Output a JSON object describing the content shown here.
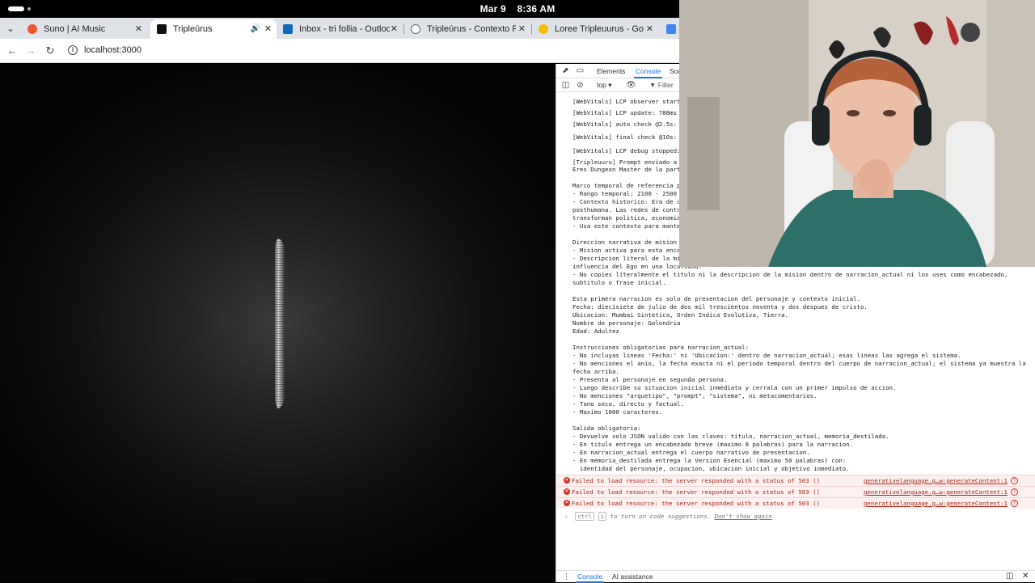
{
  "os": {
    "date": "Mar 9",
    "time": "8:36 AM"
  },
  "tabs": [
    {
      "label": "Suno | AI Music",
      "color": "#e85a2c"
    },
    {
      "label": "Tripleūrus",
      "color": "#111111"
    },
    {
      "label": "Inbox - tri follia - Outlook",
      "color": "#0f6cbd"
    },
    {
      "label": "Tripleūrus - Contexto Pr",
      "color": "#666666"
    },
    {
      "label": "Loree Tripleuurus - Goo",
      "color": "#fbbc04"
    }
  ],
  "address": {
    "url": "localhost:3000"
  },
  "devtools": {
    "tabs": {
      "elements": "Elements",
      "console": "Console",
      "sources": "Sou"
    },
    "context": "top",
    "filter": "Filter",
    "log_lines": [
      "[WebVitals] LCP observer starte",
      "[WebVitals] LCP update: 788ms",
      "[WebVitals] auto check @2.5s:",
      "[WebVitals] final check @10s:",
      "[WebVitals] LCP debug stopped:",
      "[Tripleuuru] Prompt enviado a",
      "Eres Dungeon Master de la part",
      "Marco temporal de referencia p",
      "- Rango temporal: 2100 - 2500",
      "- Contexto historico: Era de c",
      "posthumana. Las redes de contr",
      "transforman politica, economia",
      "- Usa este contexto para mante",
      "Direccion narrativa de mision",
      "- Mision activa para esta enca",
      "- Descripcion literal de la mi",
      "influencia del Ego en una localidad.",
      "- No copies literalmente el titulo ni la descripcion de la mision dentro de narracion_actual ni los uses como encabezado,",
      "subtitulo o frase inicial.",
      "Esta primera narracion es solo de presentacion del personaje y contexto inicial.",
      "Fecha: diecisiete de julio de dos mil trescientos noventa y dos despues de cristo.",
      "Ubicacion: Mumbai Sintetica, Orden Indica Evolutiva, Tierra.",
      "Nombre de personaje: Golondria",
      "Edad: Adultez",
      "Instrucciones obligatorias para narracion_actual:",
      "- No incluyas lineas 'Fecha:' ni 'Ubicacion:' dentro de narracion_actual; esas lineas las agrega el sistema.",
      "- No menciones el anio, la fecha exacta ni el periodo temporal dentro del cuerpo de narracion_actual; el sistema ya muestra la",
      "fecha arriba.",
      "- Presenta al personaje en segunda persona.",
      "- Luego describe su situacion inicial inmediata y cerrala con un primer impulso de accion.",
      "- No menciones \"arquetipo\", \"prompt\", \"sistema\", ni metacomentarios.",
      "- Tono seco, directo y factual.",
      "- Maximo 1000 caracteres.",
      "Salida obligatoria:",
      "- Devuelve solo JSON valido con las claves: titulo, narracion_actual, memoria_destilada.",
      "- En titulo entrega un encabezado breve (maximo 8 palabras) para la narracion.",
      "- En narracion_actual entrega el cuerpo narrativo de presentacion.",
      "- En memoria_destilada entrega la Version Esencial (maximo 50 palabras) con:",
      "  identidad del personaje, ocupacion, ubicacion inicial y objetivo inmediato."
    ],
    "errors": [
      {
        "message": "Failed to load resource: the server responded with a status of 503 ()",
        "source": "generativelanguage.g…w:generateContent:1"
      },
      {
        "message": "Failed to load resource: the server responded with a status of 503 ()",
        "source": "generativelanguage.g…w:generateContent:1"
      },
      {
        "message": "Failed to load resource: the server responded with a status of 503 ()",
        "source": "generativelanguage.g…w:generateContent:1"
      }
    ],
    "hint": {
      "kbd1": "ctrl",
      "kbd2": "i",
      "text": " to turn on code suggestions. ",
      "link": "Don't show again"
    },
    "drawer": {
      "console": "Console",
      "ai": "AI assistance"
    }
  }
}
